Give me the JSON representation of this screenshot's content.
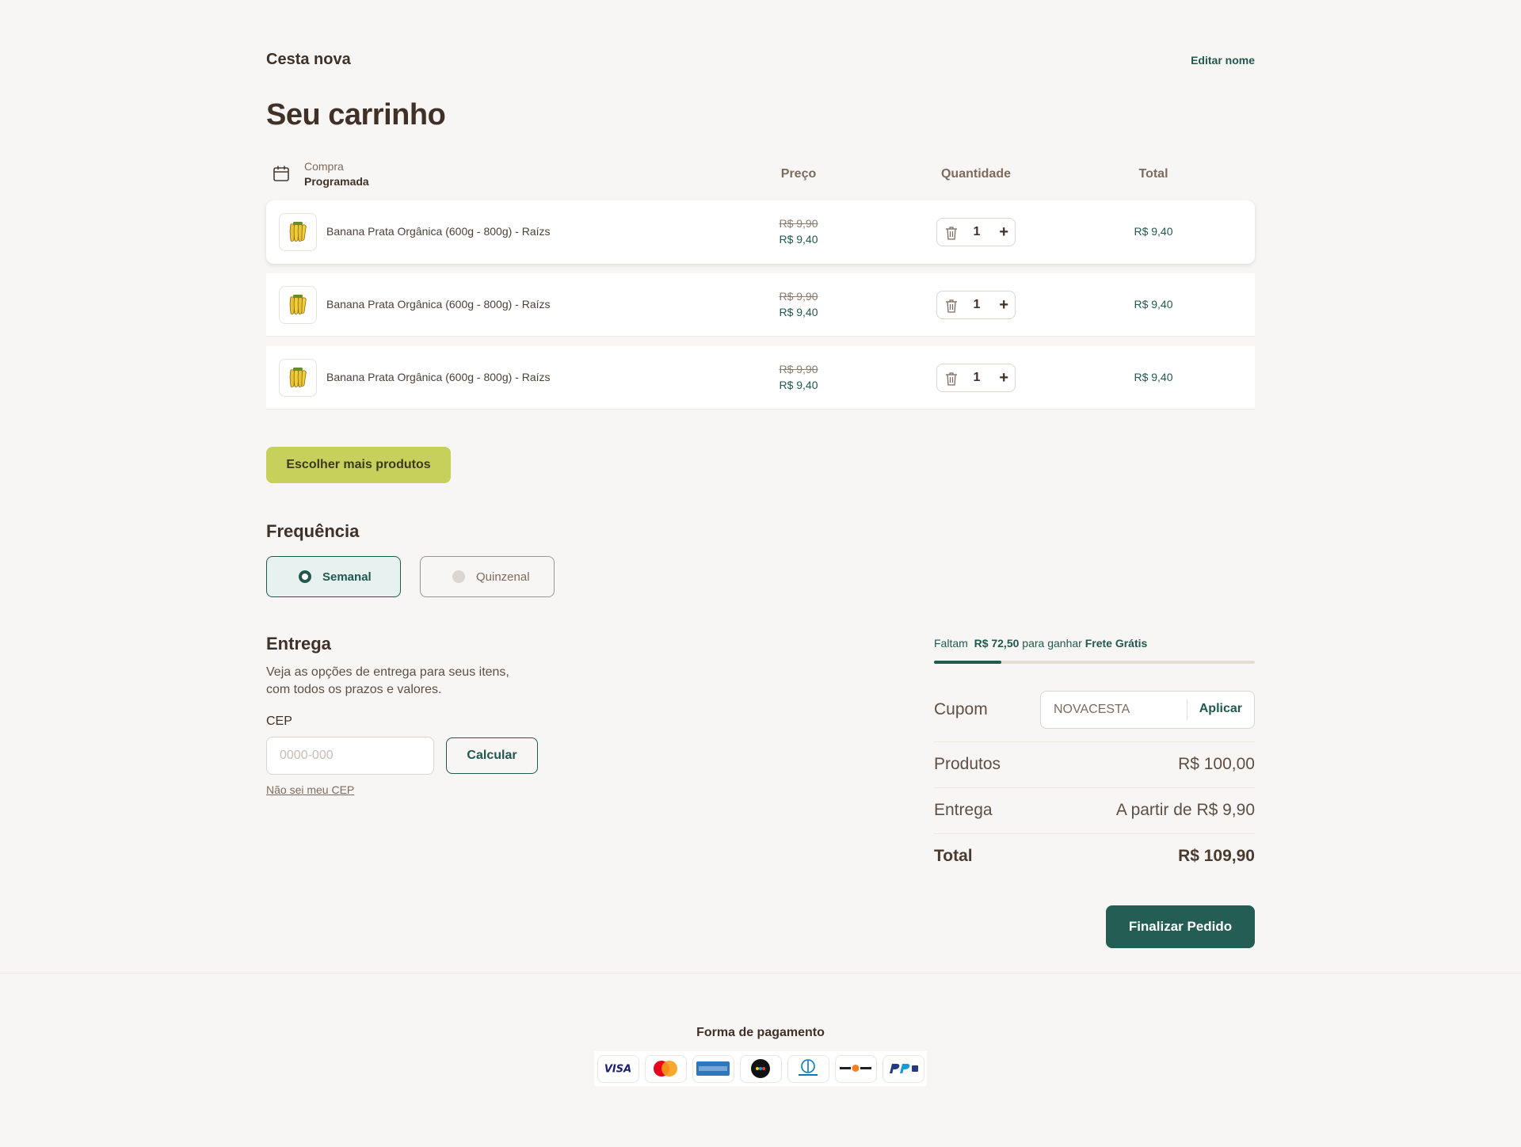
{
  "header": {
    "basket_name": "Cesta nova",
    "edit_name": "Editar nome",
    "title": "Seu carrinho"
  },
  "table": {
    "purchase_label": "Compra",
    "purchase_type": "Programada",
    "col_price": "Preço",
    "col_quantity": "Quantidade",
    "col_total": "Total",
    "items": [
      {
        "name": "Banana Prata Orgânica (600g - 800g) - Raízs",
        "old_price": "R$ 9,90",
        "price": "R$ 9,40",
        "quantity": "1",
        "total": "R$ 9,40",
        "icon": "banana-icon"
      },
      {
        "name": "Banana Prata Orgânica (600g - 800g) - Raízs",
        "old_price": "R$ 9,90",
        "price": "R$ 9,40",
        "quantity": "1",
        "total": "R$ 9,40",
        "icon": "banana-icon"
      },
      {
        "name": "Banana Prata Orgânica (600g - 800g) - Raízs",
        "old_price": "R$ 9,90",
        "price": "R$ 9,40",
        "quantity": "1",
        "total": "R$ 9,40",
        "icon": "banana-icon"
      }
    ]
  },
  "more_products_label": "Escolher mais produtos",
  "frequency": {
    "title": "Frequência",
    "options": [
      {
        "label": "Semanal",
        "selected": true
      },
      {
        "label": "Quinzenal",
        "selected": false
      }
    ]
  },
  "delivery": {
    "title": "Entrega",
    "description": "Veja as opções de entrega para seus itens, com todos os prazos e valores.",
    "cep_label": "CEP",
    "cep_placeholder": "0000-000",
    "calculate_label": "Calcular",
    "help_link": "Não sei meu CEP"
  },
  "summary": {
    "free_shipping_prefix": "Faltam",
    "free_shipping_amount": "R$ 72,50",
    "free_shipping_middle": "para ganhar",
    "free_shipping_goal": "Frete Grátis",
    "free_shipping_progress": 0.21,
    "coupon_label": "Cupom",
    "coupon_value": "NOVACESTA",
    "apply_label": "Aplicar",
    "products_label": "Produtos",
    "products_value": "R$ 100,00",
    "delivery_label": "Entrega",
    "delivery_value": "A partir de R$ 9,90",
    "total_label": "Total",
    "total_value": "R$ 109,90",
    "finish_label": "Finalizar Pedido"
  },
  "payment": {
    "title": "Forma de pagamento",
    "methods": [
      "visa-icon",
      "mastercard-icon",
      "amex-icon",
      "elo-icon",
      "diners-club-icon",
      "discover-icon",
      "paypal-icon"
    ]
  },
  "colors": {
    "primary": "#235d53",
    "accent": "#c6d05a",
    "background": "#f7f6f4"
  }
}
